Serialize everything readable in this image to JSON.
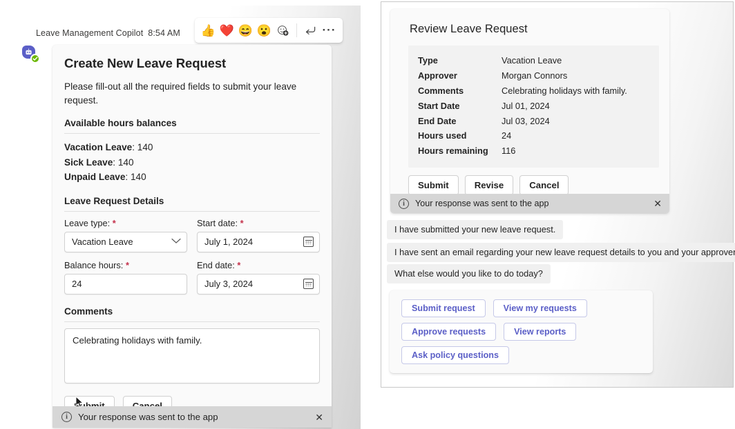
{
  "left": {
    "message_header": {
      "sender": "Leave Management Copilot",
      "time": "8:54 AM"
    },
    "reactions": [
      {
        "name": "thumbs-up-reaction",
        "glyph": "👍"
      },
      {
        "name": "heart-reaction",
        "glyph": "❤️"
      },
      {
        "name": "laugh-reaction",
        "glyph": "😄"
      },
      {
        "name": "surprised-reaction",
        "glyph": "😮"
      },
      {
        "name": "add-reaction",
        "glyph": "☺"
      }
    ],
    "reply_glyph": "↩",
    "more_glyph": "···",
    "card": {
      "title": "Create New Leave Request",
      "intro": "Please fill-out all the required fields to submit your leave request.",
      "balances_title": "Available hours balances",
      "balances": [
        {
          "label": "Vacation Leave",
          "value": "140"
        },
        {
          "label": "Sick Leave",
          "value": "140"
        },
        {
          "label": "Unpaid Leave",
          "value": "140"
        }
      ],
      "details_title": "Leave Request Details",
      "fields": {
        "leave_type_label": "Leave type:",
        "leave_type_value": "Vacation Leave",
        "start_date_label": "Start date:",
        "start_date_value": "July 1, 2024",
        "balance_hours_label": "Balance hours:",
        "balance_hours_value": "24",
        "end_date_label": "End date:",
        "end_date_value": "July 3, 2024",
        "required_marker": "*"
      },
      "comments_label": "Comments",
      "comments_value": "Celebrating holidays with family.",
      "submit_label": "Submit",
      "cancel_label": "Cancel"
    },
    "notice": {
      "text": "Your response was sent to the app",
      "info_glyph": "i",
      "close_glyph": "✕"
    }
  },
  "right": {
    "card": {
      "title": "Review Leave Request",
      "rows": [
        {
          "key": "Type",
          "value": "Vacation Leave"
        },
        {
          "key": "Approver",
          "value": "Morgan Connors"
        },
        {
          "key": "Comments",
          "value": "Celebrating holidays with family."
        },
        {
          "key": "Start Date",
          "value": "Jul 01, 2024"
        },
        {
          "key": "End Date",
          "value": "Jul 03, 2024"
        },
        {
          "key": "Hours used",
          "value": "24"
        },
        {
          "key": "Hours remaining",
          "value": "116"
        }
      ],
      "submit_label": "Submit",
      "revise_label": "Revise",
      "cancel_label": "Cancel"
    },
    "notice": {
      "text": "Your response was sent to the app",
      "info_glyph": "i",
      "close_glyph": "✕"
    },
    "messages": [
      "I have submitted your new leave request.",
      "I have sent an email regarding your new leave request details to you and your approver.",
      "What else would you like to do today?"
    ],
    "suggestions": [
      [
        "Submit request",
        "View my requests"
      ],
      [
        "Approve requests",
        "View reports"
      ],
      [
        "Ask policy questions"
      ]
    ]
  },
  "theme": {
    "accent": "#5b5fc7",
    "required": "#c4314b",
    "notice_bg": "#d6d6d6",
    "card_bg": "#fafafa"
  }
}
